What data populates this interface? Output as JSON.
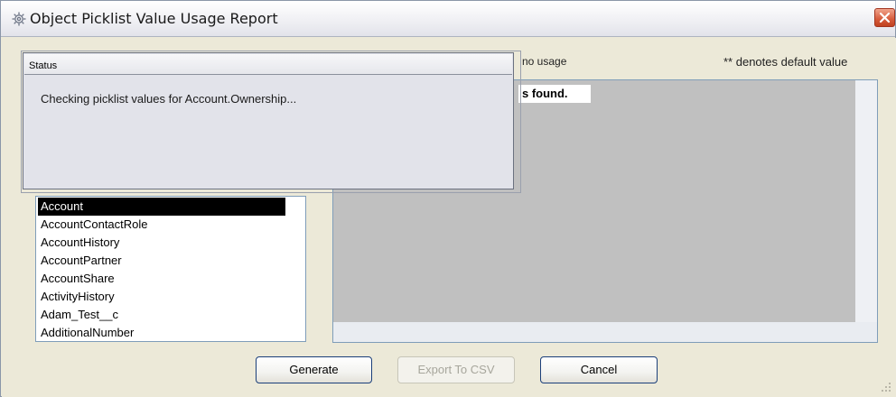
{
  "window": {
    "title": "Object Picklist Value Usage Report",
    "close_label": "✕"
  },
  "legend": {
    "no_usage": "no usage",
    "default_value": "** denotes default value"
  },
  "report": {
    "banner_text": "s found."
  },
  "object_list": {
    "selected_index": 0,
    "items": [
      "Account",
      "AccountContactRole",
      "AccountHistory",
      "AccountPartner",
      "AccountShare",
      "ActivityHistory",
      "Adam_Test__c",
      "AdditionalNumber"
    ]
  },
  "buttons": {
    "generate": "Generate",
    "export": "Export To CSV",
    "cancel": "Cancel"
  },
  "status_dialog": {
    "title": "Status",
    "message": "Checking picklist values for Account.Ownership..."
  },
  "icons": {
    "title": "gear-icon",
    "close": "close-icon",
    "scroll_up": "chevron-up-icon",
    "scroll_down": "chevron-down-icon",
    "resize": "resize-grip-icon"
  },
  "colors": {
    "close_button": "#d65a3a",
    "selection": "#000000",
    "report_background": "#c0c0c0"
  }
}
